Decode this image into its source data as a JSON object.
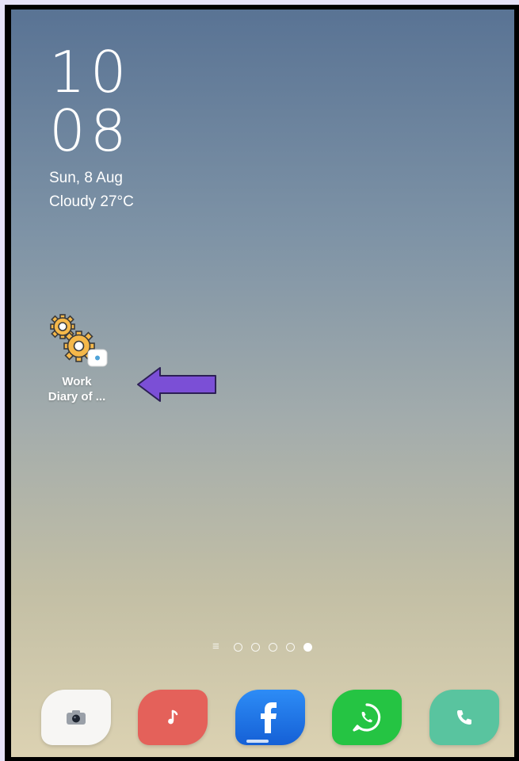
{
  "lockscreen": {
    "hour": "10",
    "minute": "08",
    "date": "Sun, 8 Aug",
    "weather": "Cloudy 27°C"
  },
  "home": {
    "shortcut": {
      "label_line1": "Work",
      "label_line2": "Diary of ...",
      "icon": "gears-icon"
    },
    "annotation_arrow": {
      "icon": "left-arrow-icon",
      "color": "#7b4fd6"
    },
    "page_indicator": {
      "pages": 5,
      "current": 5
    }
  },
  "dock": {
    "apps": [
      {
        "name": "camera",
        "icon": "camera-icon",
        "color": "#f7f6f4"
      },
      {
        "name": "music",
        "icon": "music-note-icon",
        "color": "#e4615a"
      },
      {
        "name": "facebook",
        "icon": "facebook-icon",
        "color": "#1877f2"
      },
      {
        "name": "whatsapp",
        "icon": "whatsapp-icon",
        "color": "#25c443"
      },
      {
        "name": "phone",
        "icon": "phone-icon",
        "color": "#59c49f"
      }
    ]
  }
}
